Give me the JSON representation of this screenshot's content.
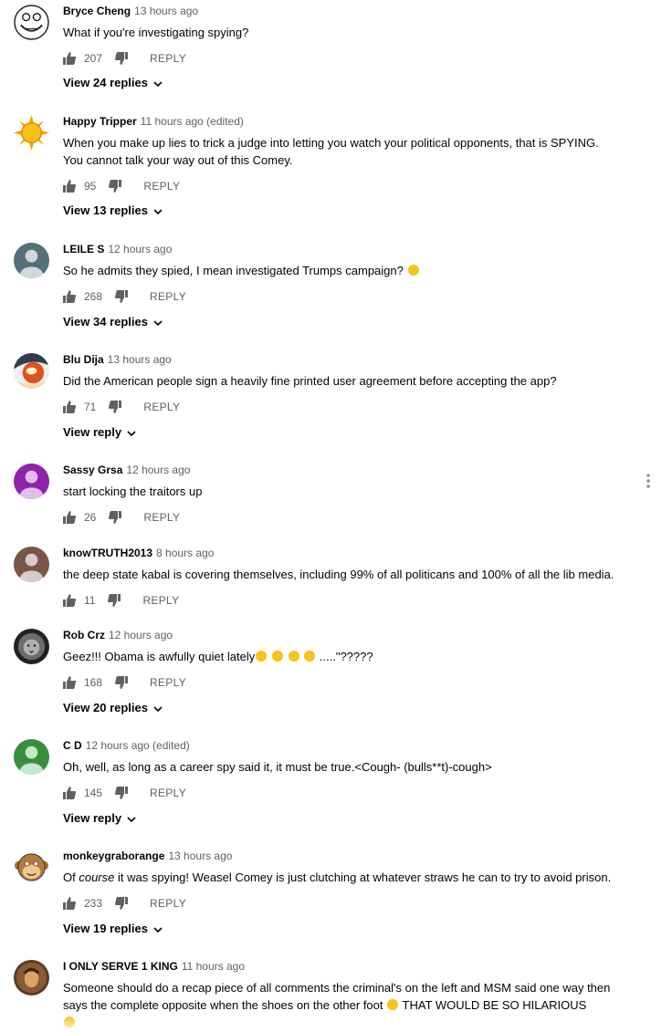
{
  "reply_label": "REPLY",
  "comments": [
    {
      "author": "Bryce Cheng",
      "time": "13 hours ago",
      "text": "What if you're investigating spying?",
      "likes": "207",
      "replies": "View 24 replies",
      "avatar": "troll-face"
    },
    {
      "author": "Happy Tripper",
      "time": "11 hours ago (edited)",
      "text": "When you make up lies to trick a judge into letting you watch your political opponents, that is SPYING. You cannot talk your way out of this Comey.",
      "likes": "95",
      "replies": "View 13 replies",
      "avatar": "sun"
    },
    {
      "author": "LEILE S",
      "time": "12 hours ago",
      "text": "So he admits they spied, I mean investigated Trumps campaign?",
      "likes": "268",
      "replies": "View 34 replies",
      "avatar": "default-slate"
    },
    {
      "author": "Blu Dija",
      "time": "13 hours ago",
      "text": "Did the American people sign a heavily fine printed user agreement before accepting the app?",
      "likes": "71",
      "replies": "View reply",
      "avatar": "photo"
    },
    {
      "author": "Sassy Grsa",
      "time": "12 hours ago",
      "text": "start locking the traitors up",
      "likes": "26",
      "replies": "",
      "avatar": "default-purple"
    },
    {
      "author": "knowTRUTH2013",
      "time": "8 hours ago",
      "text": "the deep state kabal is covering themselves, including 99% of all politicans and 100% of all the lib media.",
      "likes": "11",
      "replies": "",
      "avatar": "default-brown"
    },
    {
      "author": "Rob Crz",
      "time": "12 hours ago",
      "text": "Geez!!! Obama is awfully quiet lately",
      "text_tail": ".....\"?????",
      "likes": "168",
      "replies": "View 20 replies",
      "avatar": "lion"
    },
    {
      "author": "C D",
      "time": "12 hours ago (edited)",
      "text": "Oh, well, as long as a career spy said it, it must be true.<Cough- (bulls**t)-cough>",
      "likes": "145",
      "replies": "View reply",
      "avatar": "default-green"
    },
    {
      "author": "monkeygraborange",
      "time": "13 hours ago",
      "text_pre": "Of ",
      "text_em": "course",
      "text": " it was spying! Weasel Comey is just clutching at whatever straws he can to try to avoid prison.",
      "likes": "233",
      "replies": "View 19 replies",
      "avatar": "monkey"
    },
    {
      "author": "I ONLY SERVE 1 KING",
      "time": "11 hours ago",
      "text": "Someone should do a recap piece of all comments the criminal's on the left and MSM said one way then says the complete opposite when the shoes on the other foot",
      "text_tail": "THAT WOULD BE SO HILARIOUS",
      "likes": "",
      "replies": "",
      "avatar": "portrait"
    }
  ]
}
